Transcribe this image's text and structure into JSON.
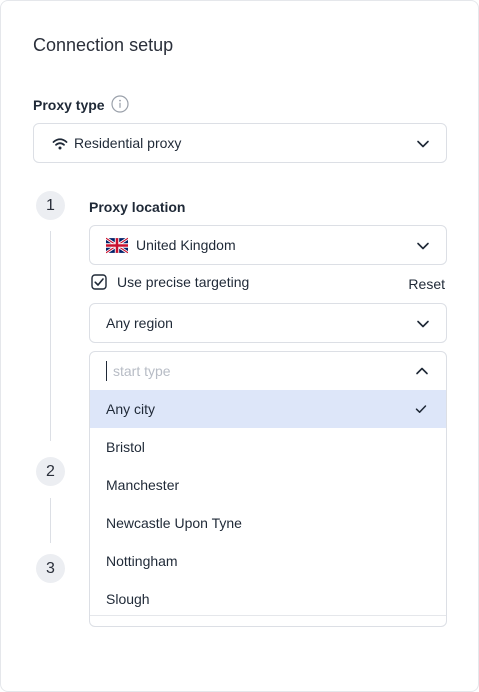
{
  "panel": {
    "title": "Connection setup"
  },
  "proxy_type": {
    "label": "Proxy type",
    "selected": "Residential proxy",
    "icons": [
      "info-icon",
      "wifi-icon",
      "chevron-down-icon"
    ]
  },
  "steps": [
    {
      "number": "1",
      "label": "Proxy location"
    },
    {
      "number": "2"
    },
    {
      "number": "3"
    }
  ],
  "location": {
    "country": "United Kingdom",
    "country_flag": "uk-flag",
    "precise_targeting_label": "Use precise targeting",
    "precise_targeting_checked": true,
    "reset_label": "Reset",
    "region": "Any region",
    "city_search_placeholder": "start type",
    "city_options": [
      "Any city",
      "Bristol",
      "Manchester",
      "Newcastle Upon Tyne",
      "Nottingham",
      "Slough"
    ],
    "city_selected": "Any city"
  },
  "colors": {
    "selected_row": "#dde6f9",
    "border": "#dcdfe5",
    "step_circle": "#eceef2"
  }
}
